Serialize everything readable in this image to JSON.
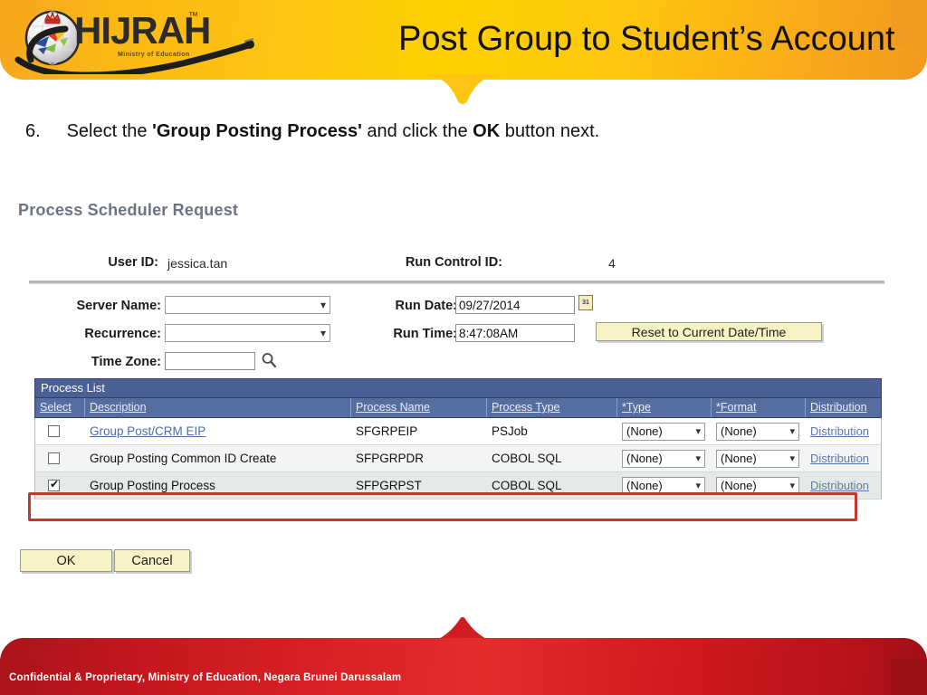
{
  "header": {
    "logo_text": "HIJRAH",
    "logo_tm": "™",
    "logo_tagline": "Ministry of Education",
    "title": "Post Group to Student’s Account",
    "bg_start": "#f5a623",
    "bg_mid": "#ffd000",
    "bg_end": "#f2991f"
  },
  "instruction": {
    "number": "6.",
    "part1": "Select the",
    "bold1": "'Group Posting Process'",
    "part2": "and click the",
    "bold2": "OK",
    "part3": "button next."
  },
  "psr": {
    "panel_title": "Process Scheduler Request",
    "user_id_label": "User ID:",
    "user_id_value": "jessica.tan",
    "run_control_label": "Run Control ID:",
    "run_control_value": "4",
    "server_name_label": "Server Name:",
    "server_name_value": "",
    "recurrence_label": "Recurrence:",
    "recurrence_value": "",
    "time_zone_label": "Time Zone:",
    "time_zone_value": "",
    "time_zone_icon": "magnifier-icon",
    "run_date_label": "Run Date:",
    "run_date_value": "09/27/2014",
    "calendar_icon": "31",
    "run_time_label": "Run Time:",
    "run_time_value": "8:47:08AM",
    "reset_button": "Reset to Current Date/Time"
  },
  "grid": {
    "title": "Process List",
    "headers": [
      "Select",
      "Description",
      "Process Name",
      "Process Type",
      "*Type",
      "*Format",
      "Distribution"
    ],
    "rows": [
      {
        "selected": false,
        "description": "Group Post/CRM EIP",
        "description_is_link": true,
        "process_name": "SFGRPEIP",
        "process_type": "PSJob",
        "type": "(None)",
        "format": "(None)",
        "distribution": "Distribution",
        "highlighted": false
      },
      {
        "selected": false,
        "description": "Group Posting Common ID Create",
        "description_is_link": false,
        "process_name": "SFPGRPDR",
        "process_type": "COBOL SQL",
        "type": "(None)",
        "format": "(None)",
        "distribution": "Distribution",
        "highlighted": false
      },
      {
        "selected": true,
        "description": "Group Posting Process",
        "description_is_link": false,
        "process_name": "SFPGRPST",
        "process_type": "COBOL SQL",
        "type": "(None)",
        "format": "(None)",
        "distribution": "Distribution",
        "highlighted": true
      }
    ],
    "header_bg": "#566da0",
    "title_bg": "#4a5f93",
    "highlight_color": "#c0392b"
  },
  "buttons": {
    "ok": "OK",
    "cancel": "Cancel"
  },
  "footer": {
    "text": "Confidential & Proprietary, Ministry of Education, Negara Brunei Darussalam",
    "bg_start": "#a8151b",
    "bg_mid": "#e32c2c",
    "bg_end": "#9e1016"
  }
}
